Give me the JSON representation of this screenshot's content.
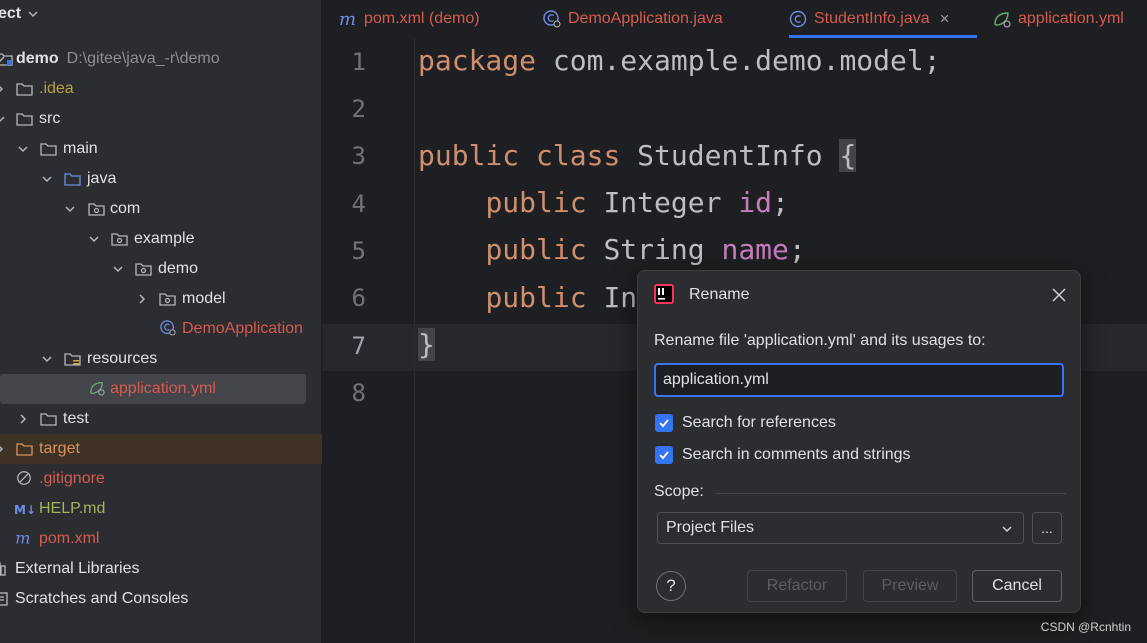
{
  "project_panel": {
    "title": "ect",
    "rows": [
      {
        "label": "demo",
        "path": "D:\\gitee\\java_-r\\demo"
      },
      {
        "label": ".idea"
      },
      {
        "label": "src"
      },
      {
        "label": "main"
      },
      {
        "label": "java"
      },
      {
        "label": "com"
      },
      {
        "label": "example"
      },
      {
        "label": "demo"
      },
      {
        "label": "model"
      },
      {
        "label": "DemoApplication"
      },
      {
        "label": "resources"
      },
      {
        "label": "application.yml"
      },
      {
        "label": "test"
      },
      {
        "label": "target"
      },
      {
        "label": ".gitignore"
      },
      {
        "label": "HELP.md"
      },
      {
        "label": "pom.xml"
      },
      {
        "label": "External Libraries"
      },
      {
        "label": "Scratches and Consoles"
      }
    ]
  },
  "editor": {
    "tabs": [
      {
        "label": "pom.xml (demo)",
        "icon": "maven-icon"
      },
      {
        "label": "DemoApplication.java",
        "icon": "spring-class-icon"
      },
      {
        "label": "StudentInfo.java",
        "icon": "class-icon",
        "close": "×"
      },
      {
        "label": "application.yml",
        "icon": "yaml-icon"
      }
    ],
    "line_numbers": [
      "1",
      "2",
      "3",
      "4",
      "5",
      "6",
      "7",
      "8"
    ],
    "code": {
      "l1_kw": "package",
      "l1_rest": " com.example.demo.model;",
      "l3_kw1": "public",
      "l3_kw2": "class",
      "l3_name": "StudentInfo",
      "l3_brace": "{",
      "l4_kw": "public",
      "l4_type": "Integer",
      "l4_field": "id",
      "l5_kw": "public",
      "l5_type": "String",
      "l5_field": "name",
      "l6_kw": "public",
      "l6_type": "In",
      "l7_brace": "}",
      "semicolon": ";"
    }
  },
  "rename_dialog": {
    "title": "Rename",
    "prompt": "Rename file 'application.yml' and its usages to:",
    "input_value": "application.yml",
    "check_refs_label": "Search for references",
    "check_comments_label": "Search in comments and strings",
    "scope_label": "Scope:",
    "scope_value": "Project Files",
    "more_label": "...",
    "help_label": "?",
    "refactor_label": "Refactor",
    "preview_label": "Preview",
    "cancel_label": "Cancel"
  },
  "watermark": "CSDN @Rcnhtin",
  "colors": {
    "accent": "#3574f0",
    "keyword": "#cf8e6d",
    "field": "#c77dbb",
    "error_file": "#d65b4f"
  }
}
